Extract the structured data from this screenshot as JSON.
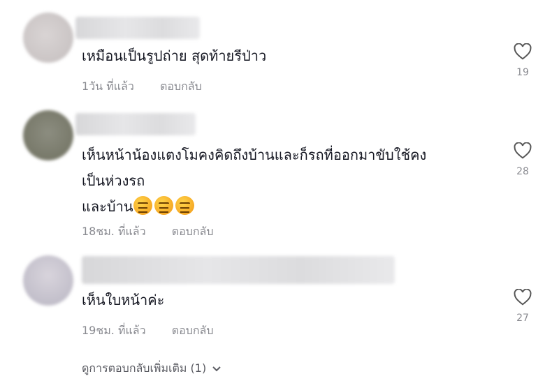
{
  "comments": [
    {
      "text_lines": [
        "เหมือนเป็นรูปถ่าย สุดท้ายรีป่าว"
      ],
      "time": "1วัน ที่แล้ว",
      "reply_label": "ตอบกลับ",
      "likes": "19"
    },
    {
      "text_lines": [
        "เห็นหน้าน้องแตงโมคงคิดถึงบ้านและก็รถที่ออกมาขับใช้คง",
        "เป็นห่วงรถ",
        "และบ้าน"
      ],
      "emoji_count": 3,
      "time": "18ชม. ที่แล้ว",
      "reply_label": "ตอบกลับ",
      "likes": "28"
    },
    {
      "text_lines": [
        "เห็นใบหน้าค่ะ"
      ],
      "time": "19ชม. ที่แล้ว",
      "reply_label": "ตอบกลับ",
      "likes": "27"
    }
  ],
  "view_more_label": "ดูการตอบกลับเพิ่มเติม (1)",
  "icons": [
    "heart-outline-icon",
    "chevron-down-icon",
    "confounded-face-emoji"
  ],
  "colors": {
    "text": "#161823",
    "muted": "#8a8b91"
  }
}
